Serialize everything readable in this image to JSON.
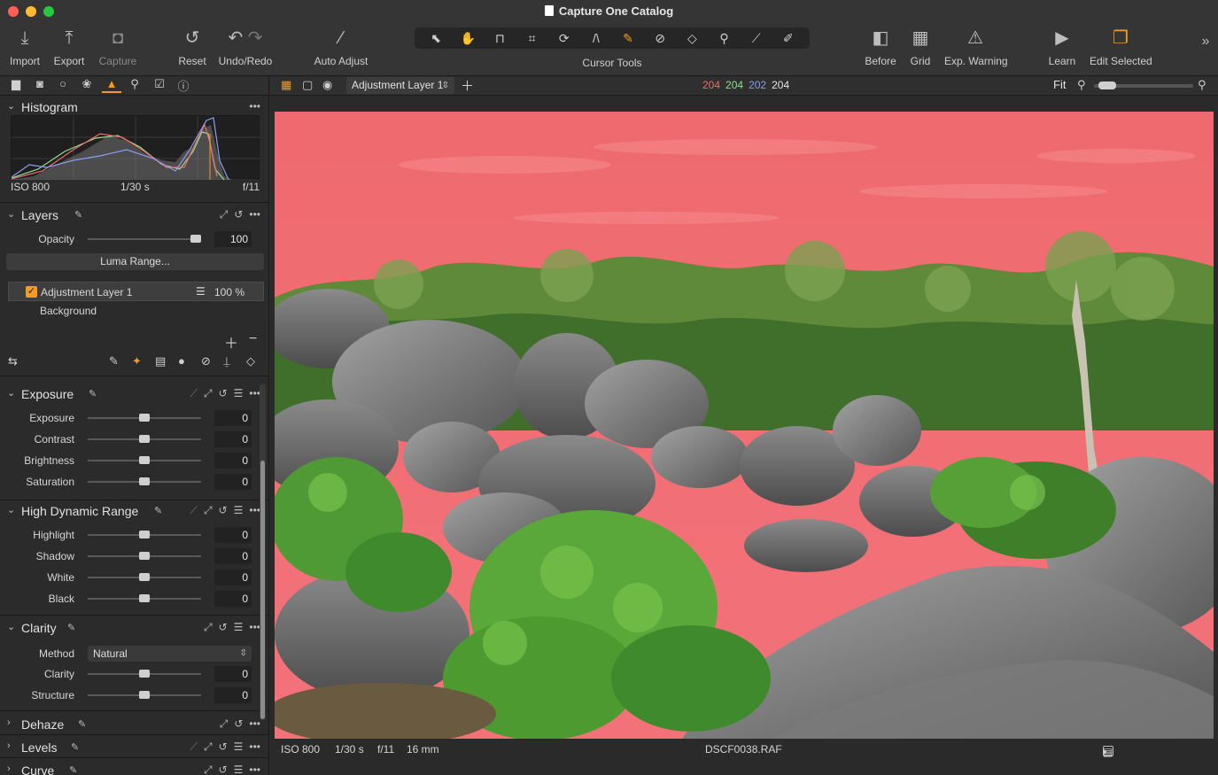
{
  "window": {
    "title": "Capture One Catalog"
  },
  "toolbar": {
    "import": "Import",
    "export": "Export",
    "capture": "Capture",
    "reset": "Reset",
    "undo_redo": "Undo/Redo",
    "auto_adjust": "Auto Adjust",
    "cursor_tools": "Cursor Tools",
    "before": "Before",
    "grid": "Grid",
    "exp_warning": "Exp. Warning",
    "learn": "Learn",
    "edit_selected": "Edit Selected"
  },
  "histogram": {
    "title": "Histogram",
    "iso": "ISO 800",
    "shutter": "1/30 s",
    "aperture": "f/11"
  },
  "layers": {
    "title": "Layers",
    "opacity_label": "Opacity",
    "opacity_value": "100",
    "opacity_level": 1.0,
    "luma_range": "Luma Range...",
    "items": [
      {
        "name": "Adjustment Layer 1",
        "opacity": "100 %",
        "checked": true
      },
      {
        "name": "Background"
      }
    ]
  },
  "exposure": {
    "title": "Exposure",
    "sliders": [
      {
        "label": "Exposure",
        "value": "0",
        "level": 0.5
      },
      {
        "label": "Contrast",
        "value": "0",
        "level": 0.5
      },
      {
        "label": "Brightness",
        "value": "0",
        "level": 0.5
      },
      {
        "label": "Saturation",
        "value": "0",
        "level": 0.5
      }
    ]
  },
  "hdr": {
    "title": "High Dynamic Range",
    "sliders": [
      {
        "label": "Highlight",
        "value": "0",
        "level": 0.5
      },
      {
        "label": "Shadow",
        "value": "0",
        "level": 0.5
      },
      {
        "label": "White",
        "value": "0",
        "level": 0.5
      },
      {
        "label": "Black",
        "value": "0",
        "level": 0.5
      }
    ]
  },
  "clarity": {
    "title": "Clarity",
    "method_label": "Method",
    "method_value": "Natural",
    "sliders": [
      {
        "label": "Clarity",
        "value": "0",
        "level": 0.5
      },
      {
        "label": "Structure",
        "value": "0",
        "level": 0.5
      }
    ]
  },
  "collapsed_tools": [
    "Dehaze",
    "Levels",
    "Curve"
  ],
  "viewer": {
    "layer_select": "Adjustment Layer 1",
    "rgb": {
      "r": "204",
      "g": "204",
      "b": "202",
      "l": "204"
    },
    "fit": "Fit",
    "zoom_level": 0.05
  },
  "status": {
    "iso": "ISO 800",
    "shutter": "1/30 s",
    "aperture": "f/11",
    "focal": "16 mm",
    "filename": "DSCF0038.RAF"
  },
  "colors": {
    "accent": "#f59b23",
    "sky": "#f06a70",
    "r": "#ef6b6b",
    "g": "#8fe08f",
    "b": "#8a9cf0"
  }
}
